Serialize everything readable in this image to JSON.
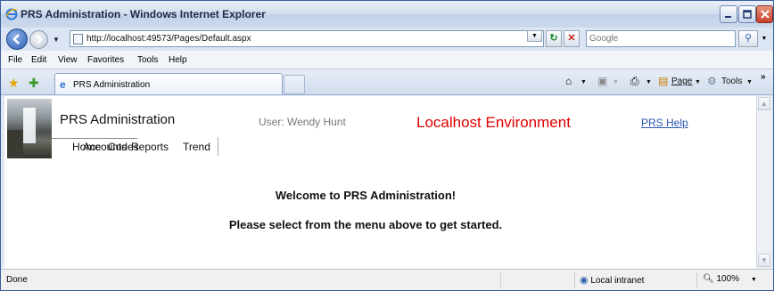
{
  "window": {
    "title": "PRS Administration - Windows Internet Explorer",
    "controls": {
      "minimize": "_",
      "maximize": "□",
      "close": "✕"
    }
  },
  "address_bar": {
    "url": "http://localhost:49573/Pages/Default.aspx",
    "search_placeholder": "Google"
  },
  "menu_bar": {
    "items": [
      "File",
      "Edit",
      "View",
      "Favorites",
      "Tools",
      "Help"
    ]
  },
  "tab_bar": {
    "active_tab_label": "PRS Administration",
    "commands": {
      "page": "Page",
      "tools": "Tools"
    }
  },
  "app": {
    "title": "PRS Administration",
    "user": "User: Wendy Hunt",
    "environment": "Localhost Environment",
    "help_link": "PRS Help",
    "environment_color": "#e10000",
    "menu_overlap": [
      "Home",
      "Accounts",
      "Codes",
      "Reports",
      "Trend"
    ]
  },
  "main": {
    "welcome": "Welcome to PRS Administration!",
    "instructions": "Please select from the menu above to get started."
  },
  "status_bar": {
    "status": "Done",
    "zone": "Local intranet",
    "zoom": "100%"
  }
}
